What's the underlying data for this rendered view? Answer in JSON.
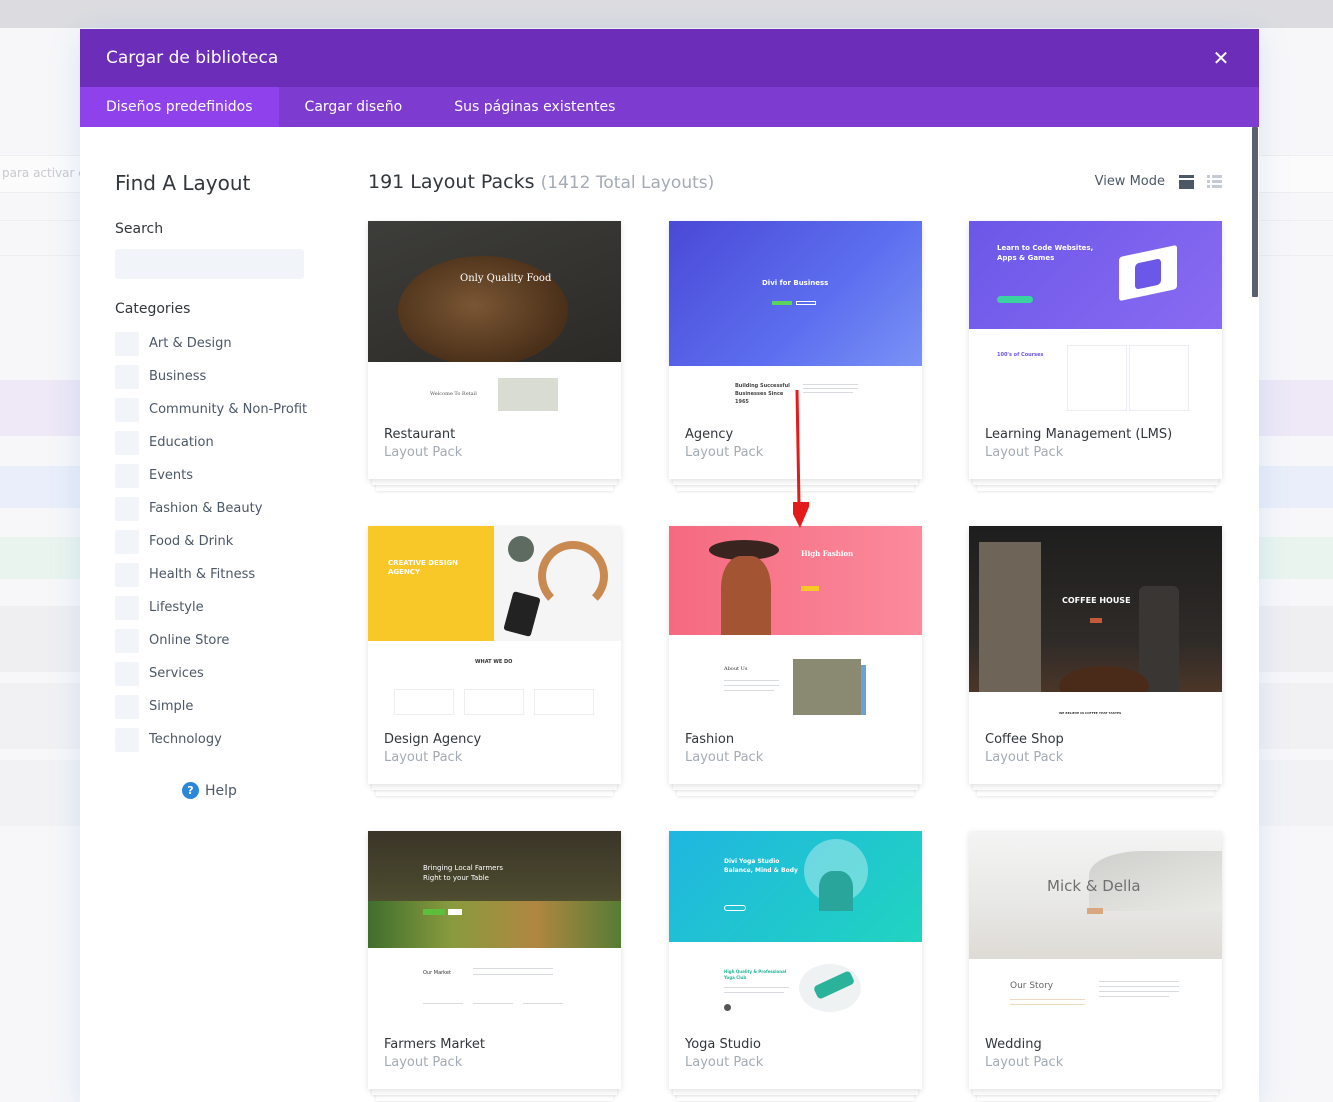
{
  "background": {
    "input_text": "para activar es"
  },
  "modal": {
    "title": "Cargar de biblioteca",
    "close_symbol": "✕",
    "tabs": [
      "Diseños predefinidos",
      "Cargar diseño",
      "Sus páginas existentes"
    ]
  },
  "sidebar": {
    "title": "Find A Layout",
    "search_label": "Search",
    "search_value": "",
    "categories_label": "Categories",
    "categories": [
      "Art & Design",
      "Business",
      "Community & Non-Profit",
      "Education",
      "Events",
      "Fashion & Beauty",
      "Food & Drink",
      "Health & Fitness",
      "Lifestyle",
      "Online Store",
      "Services",
      "Simple",
      "Technology"
    ],
    "help_icon": "?",
    "help_label": "Help"
  },
  "main": {
    "heading": "191 Layout Packs",
    "heading_sub": "(1412 Total Layouts)",
    "view_mode_label": "View Mode",
    "cards": [
      {
        "name": "Restaurant",
        "sub": "Layout Pack",
        "hero": "Only Quality Food",
        "lower": "Welcome To Retail"
      },
      {
        "name": "Agency",
        "sub": "Layout Pack",
        "hero": "Divi for Business",
        "lower": "Building Successful Businesses Since 1965"
      },
      {
        "name": "Learning Management (LMS)",
        "sub": "Layout Pack",
        "hero": "Learn to Code Websites, Apps & Games",
        "lower": "100's of Courses"
      },
      {
        "name": "Design Agency",
        "sub": "Layout Pack",
        "hero": "CREATIVE DESIGN AGENCY",
        "lower": "WHAT WE DO"
      },
      {
        "name": "Fashion",
        "sub": "Layout Pack",
        "hero": "High Fashion",
        "lower": "About Us"
      },
      {
        "name": "Coffee Shop",
        "sub": "Layout Pack",
        "hero": "COFFEE HOUSE",
        "lower": "WE BELIEVE IN COFFEE THAT TASTES"
      },
      {
        "name": "Farmers Market",
        "sub": "Layout Pack",
        "hero": "Bringing Local Farmers Right to your Table",
        "lower": "Our Market"
      },
      {
        "name": "Yoga Studio",
        "sub": "Layout Pack",
        "hero": "Divi Yoga Studio Balance, Mind & Body",
        "lower": "High Quality & Professional Yoga Club"
      },
      {
        "name": "Wedding",
        "sub": "Layout Pack",
        "hero": "Mick & Della",
        "lower": "Our Story"
      }
    ]
  },
  "colors": {
    "header": "#6c2eb9",
    "tabs": "#7e3bd0",
    "tab_active": "#8f42ec",
    "accent_blue": "#2b87da",
    "arrow": "#e31b1b"
  },
  "icons": [
    "close-icon",
    "grid-view-icon",
    "list-view-icon",
    "help-icon",
    "arrow-annotation"
  ]
}
